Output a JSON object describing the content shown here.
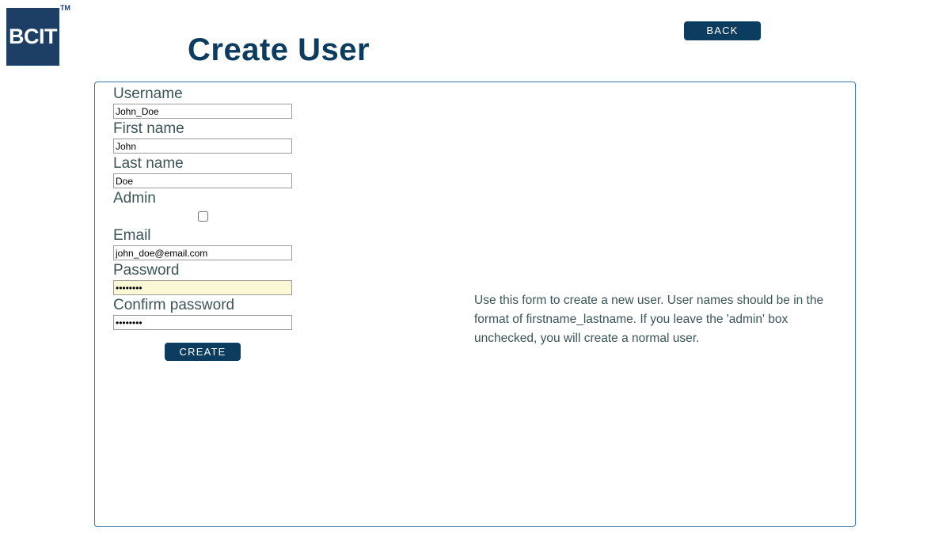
{
  "header": {
    "logo_text": "BCIT",
    "logo_trademark": "TM",
    "title": "Create User",
    "back_label": "BACK"
  },
  "colors": {
    "brand_navy": "#0d3c61",
    "logo_navy": "#1d3f66",
    "panel_border": "#3a77ad",
    "label_slate": "#3c5557",
    "autofill_yellow": "#fbf8d5"
  },
  "form": {
    "fields": [
      {
        "label": "Username",
        "name": "username",
        "type": "text",
        "value": "John_Doe",
        "autofilled": false
      },
      {
        "label": "First name",
        "name": "first-name",
        "type": "text",
        "value": "John",
        "autofilled": false
      },
      {
        "label": "Last name",
        "name": "last-name",
        "type": "text",
        "value": "Doe",
        "autofilled": false
      },
      {
        "label": "Admin",
        "name": "admin",
        "type": "checkbox",
        "value": "",
        "checked": false
      },
      {
        "label": "Email",
        "name": "email",
        "type": "text",
        "value": "john_doe@email.com",
        "autofilled": false
      },
      {
        "label": "Password",
        "name": "password",
        "type": "password",
        "value": "password",
        "autofilled": true
      },
      {
        "label": "Confirm password",
        "name": "confirm-password",
        "type": "password",
        "value": "password",
        "autofilled": false
      }
    ],
    "submit_label": "CREATE"
  },
  "help": {
    "text": "Use this form to create a new user. User names should be in the format of firstname_lastname. If you leave the 'admin' box unchecked, you will create a normal user."
  }
}
